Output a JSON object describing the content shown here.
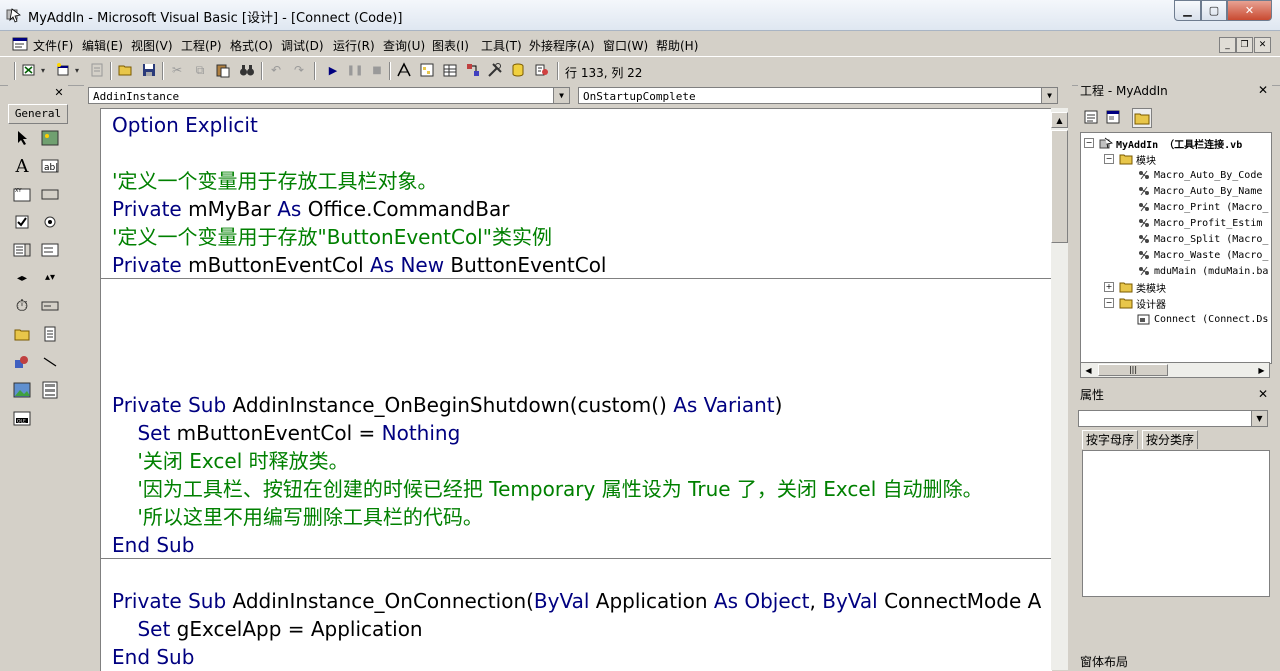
{
  "window": {
    "title": "MyAddIn - Microsoft Visual Basic [设计] - [Connect (Code)]",
    "minimize_label": "▁",
    "maximize_label": "▢",
    "close_label": "✕"
  },
  "menubar": {
    "items": [
      "文件(F)",
      "编辑(E)",
      "视图(V)",
      "工程(P)",
      "格式(O)",
      "调试(D)",
      "运行(R)",
      "查询(U)",
      "图表(I)",
      "工具(T)",
      "外接程序(A)",
      "窗口(W)",
      "帮助(H)"
    ],
    "mdi_min": "_",
    "mdi_restore": "❐",
    "mdi_close": "✕"
  },
  "toolbar": {
    "position_text": "行 133, 列 22"
  },
  "toolbox": {
    "tab_label": "General",
    "close_label": "✕"
  },
  "code_window": {
    "object_combo": "AddinInstance",
    "proc_combo": "OnStartupComplete",
    "lines": [
      {
        "segments": [
          {
            "t": "kw",
            "s": "Option Explicit"
          }
        ]
      },
      {
        "segments": []
      },
      {
        "segments": [
          {
            "t": "cm",
            "s": "'定义一个变量用于存放工具栏对象。"
          }
        ]
      },
      {
        "segments": [
          {
            "t": "kw",
            "s": "Private"
          },
          {
            "t": "tx",
            "s": " mMyBar "
          },
          {
            "t": "kw",
            "s": "As"
          },
          {
            "t": "tx",
            "s": " Office.CommandBar"
          }
        ]
      },
      {
        "segments": [
          {
            "t": "cm",
            "s": "'定义一个变量用于存放\"ButtonEventCol\"类实例"
          }
        ]
      },
      {
        "segments": [
          {
            "t": "kw",
            "s": "Private"
          },
          {
            "t": "tx",
            "s": " mButtonEventCol "
          },
          {
            "t": "kw",
            "s": "As New"
          },
          {
            "t": "tx",
            "s": " ButtonEventCol"
          }
        ]
      },
      {
        "segments": []
      },
      {
        "segments": []
      },
      {
        "segments": []
      },
      {
        "segments": []
      },
      {
        "segments": [
          {
            "t": "kw",
            "s": "Private Sub"
          },
          {
            "t": "tx",
            "s": " AddinInstance_OnBeginShutdown(custom() "
          },
          {
            "t": "kw",
            "s": "As"
          },
          {
            "t": "kw",
            "s": " Variant"
          },
          {
            "t": "tx",
            "s": ")"
          }
        ]
      },
      {
        "segments": [
          {
            "t": "tx",
            "s": "    "
          },
          {
            "t": "kw",
            "s": "Set"
          },
          {
            "t": "tx",
            "s": " mButtonEventCol = "
          },
          {
            "t": "kw",
            "s": "Nothing"
          }
        ]
      },
      {
        "segments": [
          {
            "t": "cm",
            "s": "    '关闭 Excel 时释放类。"
          }
        ]
      },
      {
        "segments": [
          {
            "t": "cm",
            "s": "    '因为工具栏、按钮在创建的时候已经把 Temporary 属性设为 True 了，关闭 Excel 自动删除。"
          }
        ]
      },
      {
        "segments": [
          {
            "t": "cm",
            "s": "    '所以这里不用编写删除工具栏的代码。"
          }
        ]
      },
      {
        "segments": [
          {
            "t": "kw",
            "s": "End Sub"
          }
        ]
      },
      {
        "segments": []
      },
      {
        "segments": [
          {
            "t": "kw",
            "s": "Private Sub"
          },
          {
            "t": "tx",
            "s": " AddinInstance_OnConnection("
          },
          {
            "t": "kw",
            "s": "ByVal"
          },
          {
            "t": "tx",
            "s": " Application "
          },
          {
            "t": "kw",
            "s": "As Object"
          },
          {
            "t": "tx",
            "s": ", "
          },
          {
            "t": "kw",
            "s": "ByVal"
          },
          {
            "t": "tx",
            "s": " ConnectMode A"
          }
        ]
      },
      {
        "segments": [
          {
            "t": "tx",
            "s": "    "
          },
          {
            "t": "kw",
            "s": "Set"
          },
          {
            "t": "tx",
            "s": " gExcelApp = Application"
          }
        ]
      },
      {
        "segments": [
          {
            "t": "kw",
            "s": "End Sub"
          }
        ]
      }
    ]
  },
  "project_pane": {
    "title": "工程 - MyAddIn",
    "close_label": "✕",
    "tree": [
      {
        "label": "MyAddIn （工具栏连接.vb",
        "level": 0,
        "icon": "project-icon",
        "bold": true,
        "expander": "−"
      },
      {
        "label": "模块",
        "level": 1,
        "icon": "folder-icon",
        "expander": "−"
      },
      {
        "label": "Macro_Auto_By_Code",
        "level": 2,
        "icon": "module-icon"
      },
      {
        "label": "Macro_Auto_By_Name",
        "level": 2,
        "icon": "module-icon"
      },
      {
        "label": "Macro_Print (Macro_",
        "level": 2,
        "icon": "module-icon"
      },
      {
        "label": "Macro_Profit_Estim",
        "level": 2,
        "icon": "module-icon"
      },
      {
        "label": "Macro_Split (Macro_",
        "level": 2,
        "icon": "module-icon"
      },
      {
        "label": "Macro_Waste (Macro_",
        "level": 2,
        "icon": "module-icon"
      },
      {
        "label": "mduMain (mduMain.ba",
        "level": 2,
        "icon": "module-icon"
      },
      {
        "label": "类模块",
        "level": 1,
        "icon": "folder-icon",
        "expander": "+"
      },
      {
        "label": "设计器",
        "level": 1,
        "icon": "folder-icon",
        "expander": "−"
      },
      {
        "label": "Connect (Connect.Ds",
        "level": 2,
        "icon": "designer-icon"
      }
    ],
    "hscroll_thumb": "|||"
  },
  "properties_pane": {
    "title": "属性",
    "close_label": "✕",
    "tab_alpha": "按字母序",
    "tab_category": "按分类序"
  },
  "form_layout": {
    "title": "窗体布局"
  }
}
